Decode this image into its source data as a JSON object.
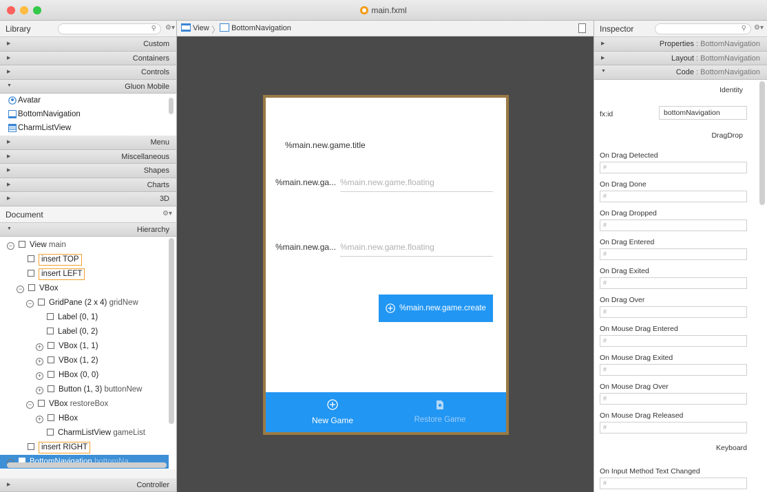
{
  "window": {
    "title": "main.fxml"
  },
  "library": {
    "title": "Library",
    "sections_top": [
      "Custom",
      "Containers",
      "Controls",
      "Gluon Mobile"
    ],
    "items": [
      "Avatar",
      "BottomNavigation",
      "CharmListView"
    ],
    "sections_bottom": [
      "Menu",
      "Miscellaneous",
      "Shapes",
      "Charts",
      "3D"
    ]
  },
  "document": {
    "title": "Document",
    "hierarchy_label": "Hierarchy",
    "controller_label": "Controller",
    "tree": [
      {
        "label": "View",
        "sub": "main"
      },
      {
        "label": "insert TOP",
        "sub": ""
      },
      {
        "label": "insert LEFT",
        "sub": ""
      },
      {
        "label": "VBox",
        "sub": ""
      },
      {
        "label": "GridPane (2 x 4)",
        "sub": "gridNew"
      },
      {
        "label": "Label (0, 1)",
        "sub": ""
      },
      {
        "label": "Label (0, 2)",
        "sub": ""
      },
      {
        "label": "VBox (1, 1)",
        "sub": ""
      },
      {
        "label": "VBox (1, 2)",
        "sub": ""
      },
      {
        "label": "HBox (0, 0)",
        "sub": ""
      },
      {
        "label": "Button (1, 3)",
        "sub": "buttonNew"
      },
      {
        "label": "VBox",
        "sub": "restoreBox"
      },
      {
        "label": "HBox",
        "sub": ""
      },
      {
        "label": "CharmListView",
        "sub": "gameList"
      },
      {
        "label": "insert RIGHT",
        "sub": ""
      },
      {
        "label": "BottomNavigation",
        "sub": "bottomNa"
      }
    ]
  },
  "breadcrumb": {
    "root": "View",
    "current": "BottomNavigation"
  },
  "canvas": {
    "title_text": "%main.new.game.title",
    "row1_label": "%main.new.ga...",
    "row1_prompt": "%main.new.game.floating",
    "row2_label": "%main.new.ga...",
    "row2_prompt": "%main.new.game.floating",
    "create_button": "%main.new.game.create",
    "nav_new_game": "New Game",
    "nav_restore_game": "Restore Game"
  },
  "inspector": {
    "title": "Inspector",
    "sections": [
      {
        "name": "Properties",
        "target": "BottomNavigation"
      },
      {
        "name": "Layout",
        "target": "BottomNavigation"
      },
      {
        "name": "Code",
        "target": "BottomNavigation"
      }
    ],
    "identity_header": "Identity",
    "fxid_label": "fx:id",
    "fxid_value": "bottomNavigation",
    "dragdrop_header": "DragDrop",
    "keyboard_header": "Keyboard",
    "events": [
      "On Drag Detected",
      "On Drag Done",
      "On Drag Dropped",
      "On Drag Entered",
      "On Drag Exited",
      "On Drag Over",
      "On Mouse Drag Entered",
      "On Mouse Drag Exited",
      "On Mouse Drag Over",
      "On Mouse Drag Released"
    ],
    "keyboard_events": [
      "On Input Method Text Changed"
    ],
    "hash": "#"
  },
  "colors": {
    "accent": "#2196f3",
    "selection": "#3d8fd6",
    "frame": "#9a7a45"
  }
}
